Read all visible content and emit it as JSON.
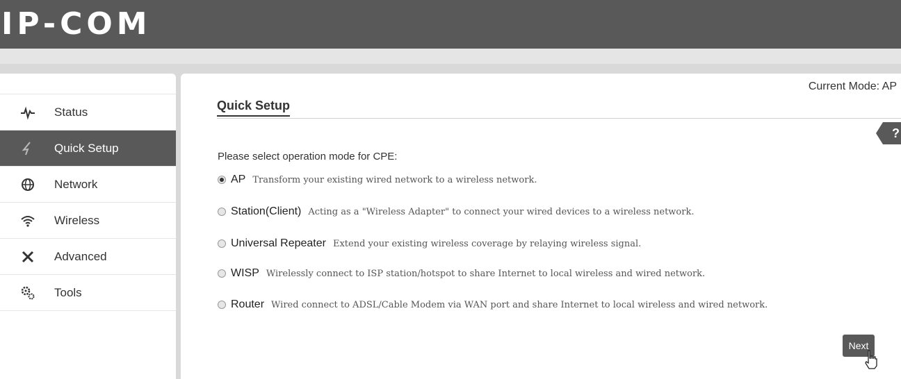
{
  "header": {
    "logo": "IP-COM"
  },
  "sidebar": {
    "items": [
      {
        "label": "Status",
        "icon": "pulse-icon"
      },
      {
        "label": "Quick Setup",
        "icon": "lightning-icon",
        "active": true
      },
      {
        "label": "Network",
        "icon": "globe-icon"
      },
      {
        "label": "Wireless",
        "icon": "wifi-icon"
      },
      {
        "label": "Advanced",
        "icon": "tools-icon"
      },
      {
        "label": "Tools",
        "icon": "gears-icon"
      }
    ]
  },
  "main": {
    "current_mode": "Current Mode: AP",
    "title": "Quick Setup",
    "help": "?",
    "prompt": "Please select operation mode for CPE:",
    "options": [
      {
        "name": "AP",
        "desc": "Transform your existing wired network to a wireless network.",
        "selected": true
      },
      {
        "name": "Station(Client)",
        "desc": "Acting as a \"Wireless Adapter\" to connect your wired devices to a wireless network.",
        "selected": false
      },
      {
        "name": "Universal Repeater",
        "desc": "Extend your existing wireless coverage by relaying wireless signal.",
        "selected": false
      },
      {
        "name": "WISP",
        "desc": "Wirelessly connect to ISP station/hotspot to share Internet to local wireless and wired network.",
        "selected": false
      },
      {
        "name": "Router",
        "desc": "Wired connect to ADSL/Cable Modem via WAN port and share Internet to local wireless and wired network.",
        "selected": false
      }
    ],
    "next_label": "Next"
  },
  "colors": {
    "dark": "#595959",
    "background": "#d9d9d9"
  }
}
